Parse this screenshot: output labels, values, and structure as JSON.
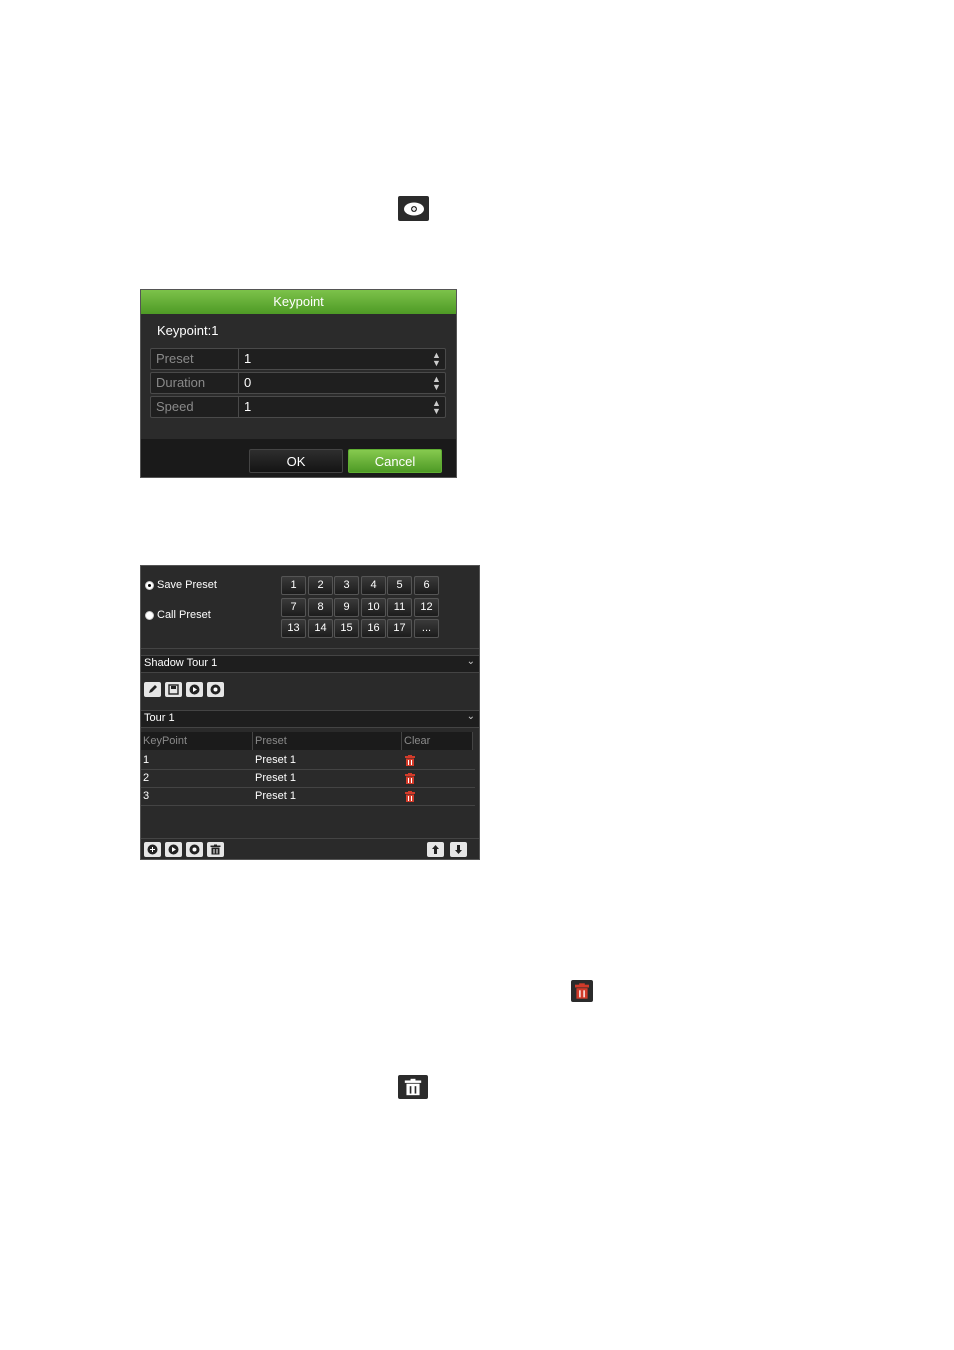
{
  "icons": {
    "top_icon": "add-keypoint-icon",
    "mid_icon": "delete-red-icon",
    "bottom_icon": "trash-icon"
  },
  "keypoint_dialog": {
    "title": "Keypoint",
    "subtitle": "Keypoint:1",
    "rows": [
      {
        "label": "Preset",
        "value": "1"
      },
      {
        "label": "Duration",
        "value": "0"
      },
      {
        "label": "Speed",
        "value": "1"
      }
    ],
    "ok_label": "OK",
    "cancel_label": "Cancel"
  },
  "ptz_panel": {
    "save_preset_label": "Save Preset",
    "call_preset_label": "Call Preset",
    "preset_buttons": [
      "1",
      "2",
      "3",
      "4",
      "5",
      "6",
      "7",
      "8",
      "9",
      "10",
      "11",
      "12",
      "13",
      "14",
      "15",
      "16",
      "17",
      "..."
    ],
    "shadow_tour_label": "Shadow Tour 1",
    "tour_label": "Tour 1",
    "table": {
      "headers": [
        "KeyPoint",
        "Preset",
        "Clear"
      ],
      "rows": [
        {
          "keypoint": "1",
          "preset": "Preset 1"
        },
        {
          "keypoint": "2",
          "preset": "Preset 1"
        },
        {
          "keypoint": "3",
          "preset": "Preset 1"
        }
      ]
    }
  },
  "colors": {
    "accent_green": "#6ab63a",
    "panel_bg": "#2a2a2a",
    "delete_red": "#d23b2a"
  }
}
